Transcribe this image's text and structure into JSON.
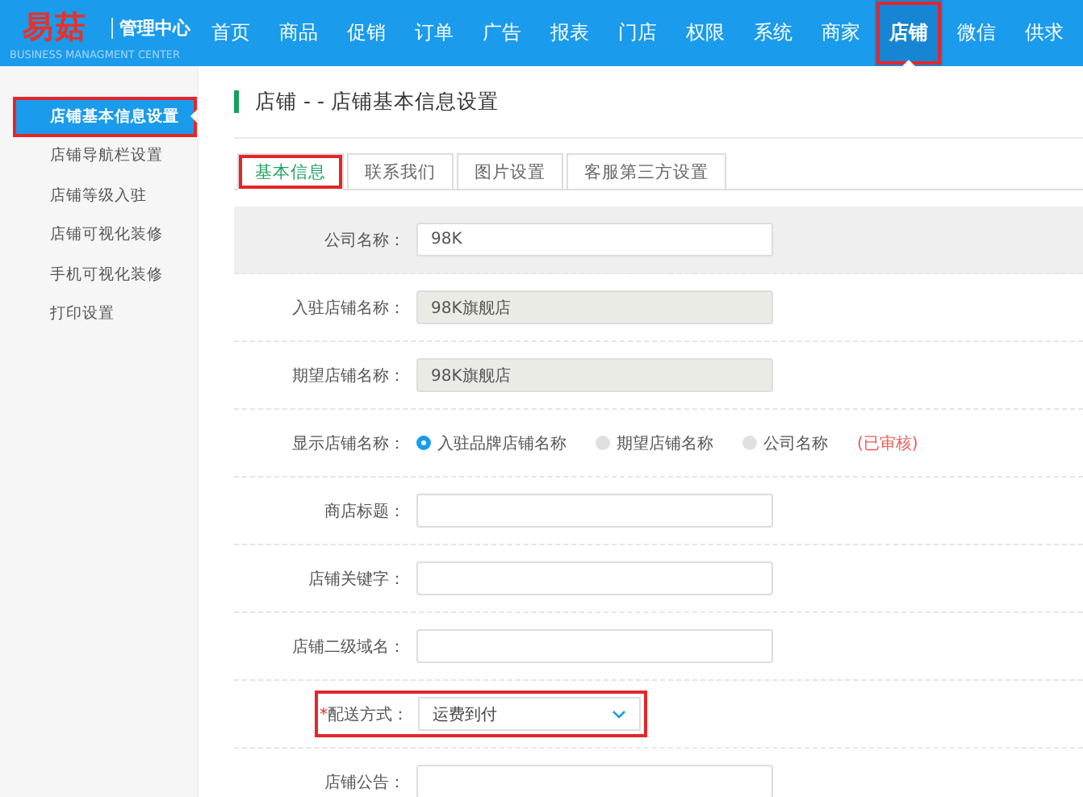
{
  "header": {
    "logo": "易菇",
    "subtitle": "管理中心",
    "tagline": "BUSINESS MANAGMENT CENTER"
  },
  "nav": [
    {
      "label": "首页",
      "selected": false,
      "highlighted": false
    },
    {
      "label": "商品",
      "selected": false,
      "highlighted": false
    },
    {
      "label": "促销",
      "selected": false,
      "highlighted": false
    },
    {
      "label": "订单",
      "selected": false,
      "highlighted": false
    },
    {
      "label": "广告",
      "selected": false,
      "highlighted": false
    },
    {
      "label": "报表",
      "selected": false,
      "highlighted": false
    },
    {
      "label": "门店",
      "selected": false,
      "highlighted": false
    },
    {
      "label": "权限",
      "selected": false,
      "highlighted": false
    },
    {
      "label": "系统",
      "selected": false,
      "highlighted": false
    },
    {
      "label": "商家",
      "selected": false,
      "highlighted": false
    },
    {
      "label": "店铺",
      "selected": true,
      "highlighted": true
    },
    {
      "label": "微信",
      "selected": false,
      "highlighted": false
    },
    {
      "label": "供求",
      "selected": false,
      "highlighted": false
    }
  ],
  "sidebar": {
    "items": [
      {
        "label": "店铺基本信息设置",
        "selected": true,
        "highlighted": true
      },
      {
        "label": "店铺导航栏设置",
        "selected": false,
        "highlighted": false
      },
      {
        "label": "店铺等级入驻",
        "selected": false,
        "highlighted": false
      },
      {
        "label": "店铺可视化装修",
        "selected": false,
        "highlighted": false
      },
      {
        "label": "手机可视化装修",
        "selected": false,
        "highlighted": false
      },
      {
        "label": "打印设置",
        "selected": false,
        "highlighted": false
      }
    ]
  },
  "page": {
    "title": "店铺 - - 店铺基本信息设置"
  },
  "tabs": [
    {
      "label": "基本信息",
      "selected": true,
      "highlighted": true
    },
    {
      "label": "联系我们",
      "selected": false,
      "highlighted": false
    },
    {
      "label": "图片设置",
      "selected": false,
      "highlighted": false
    },
    {
      "label": "客服第三方设置",
      "selected": false,
      "highlighted": false
    }
  ],
  "form": {
    "rows": [
      {
        "kind": "text",
        "label": "公司名称：",
        "value": "98K",
        "disabled": false,
        "hovered": true,
        "highlighted": false
      },
      {
        "kind": "text",
        "label": "入驻店铺名称：",
        "value": "98K旗舰店",
        "disabled": true,
        "hovered": false,
        "highlighted": false
      },
      {
        "kind": "text",
        "label": "期望店铺名称：",
        "value": "98K旗舰店",
        "disabled": true,
        "hovered": false,
        "highlighted": false
      },
      {
        "kind": "radio",
        "label": "显示店铺名称：",
        "options": [
          {
            "label": "入驻品牌店铺名称",
            "selected": true
          },
          {
            "label": "期望店铺名称",
            "selected": false
          },
          {
            "label": "公司名称",
            "selected": false
          }
        ],
        "note": "(已审核)",
        "hovered": false,
        "highlighted": false
      },
      {
        "kind": "text",
        "label": "商店标题：",
        "disabled": false,
        "hovered": false,
        "highlighted": false
      },
      {
        "kind": "text",
        "label": "店铺关键字：",
        "disabled": false,
        "hovered": false,
        "highlighted": false
      },
      {
        "kind": "text",
        "label": "店铺二级域名：",
        "disabled": false,
        "hovered": false,
        "highlighted": false
      },
      {
        "kind": "select",
        "label": "配送方式：",
        "required_mark": "*",
        "value": "运费到付",
        "hovered": false,
        "highlighted": true
      },
      {
        "kind": "text",
        "label": "店铺公告：",
        "disabled": false,
        "hovered": false,
        "highlighted": false
      }
    ]
  }
}
